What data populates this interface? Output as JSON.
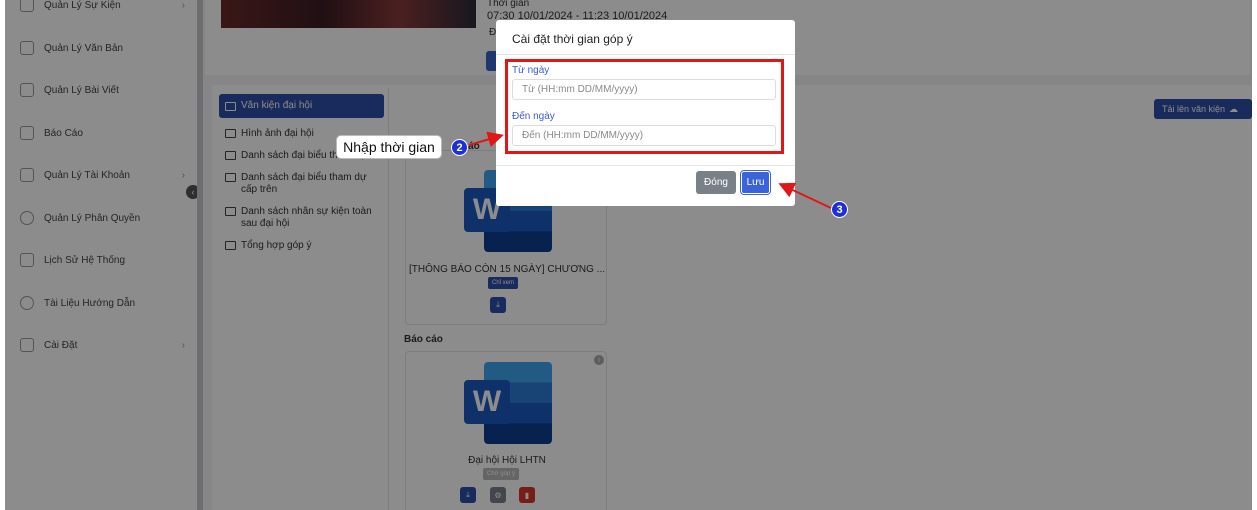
{
  "sidebar": {
    "items": [
      {
        "label": "Quản Lý Sự Kiện",
        "has_arrow": true
      },
      {
        "label": "Quản Lý Văn Bản",
        "has_arrow": false
      },
      {
        "label": "Quản Lý Bài Viết",
        "has_arrow": false
      },
      {
        "label": "Báo Cáo",
        "has_arrow": false
      },
      {
        "label": "Quản Lý Tài Khoản",
        "has_arrow": true
      },
      {
        "label": "Quản Lý Phân Quyền",
        "has_arrow": false
      },
      {
        "label": "Lịch Sử Hệ Thống",
        "has_arrow": false
      },
      {
        "label": "Tài Liệu Hướng Dẫn",
        "has_arrow": false
      },
      {
        "label": "Cài Đặt",
        "has_arrow": true
      }
    ],
    "arrow_glyph": "›",
    "collapse_glyph": "‹"
  },
  "event": {
    "time": "07:30 10/01/2024 - 11:23 10/01/2024",
    "heading": "Thời gian",
    "letter": "Đ"
  },
  "folders": [
    {
      "label": "Văn kiện đại hội",
      "active": true
    },
    {
      "label": "Hình ảnh đại hội",
      "active": false
    },
    {
      "label": "Danh sách đại biểu tham dự",
      "active": false
    },
    {
      "label": "Danh sách đại biểu tham dự cấp trên",
      "active": false
    },
    {
      "label": "Danh sách nhân sự kiện toàn sau đại hội",
      "active": false
    },
    {
      "label": "Tổng hợp góp ý",
      "active": false
    }
  ],
  "upload_button": {
    "label": "Tải lên văn kiện"
  },
  "sections": {
    "section1_suffix": "báo",
    "section2_title": "Báo cáo"
  },
  "documents": [
    {
      "name": "[THÔNG BÁO CÒN 15 NGÀY] CHƯƠNG ...",
      "tag": "Chỉ xem",
      "tag_color": "#2f4ea8"
    },
    {
      "name": "Đại hội Hội LHTN",
      "tag": "Chờ góp ý",
      "tag_color": "#b9b9b9"
    }
  ],
  "modal": {
    "title": "Cài đặt thời gian góp ý",
    "from_label": "Từ ngày",
    "from_placeholder": "Từ (HH:mm DD/MM/yyyy)",
    "to_label": "Đến ngày",
    "to_placeholder": "Đến (HH:mm DD/MM/yyyy)",
    "close_label": "Đóng",
    "save_label": "Lưu"
  },
  "annotations": {
    "callout_text": "Nhập thời gian",
    "step2": "2",
    "step3": "3",
    "highlight_color": "#e01717",
    "marker_color": "#1d2fd6"
  },
  "colors": {
    "primary": "#2f4ea8",
    "save": "#3b63d9",
    "close": "#7a8088",
    "danger": "#d9342b"
  }
}
